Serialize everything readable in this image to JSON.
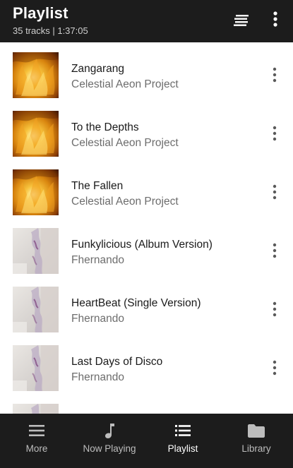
{
  "header": {
    "title": "Playlist",
    "subtitle": "35 tracks | 1:37:05",
    "sort_icon": "queue-sort-icon",
    "overflow_icon": "more-vert-icon"
  },
  "tracks": [
    {
      "title": "Zangarang",
      "artist": "Celestial Aeon Project",
      "art": "fire"
    },
    {
      "title": "To the Depths",
      "artist": "Celestial Aeon Project",
      "art": "fire"
    },
    {
      "title": "The Fallen",
      "artist": "Celestial Aeon Project",
      "art": "fire"
    },
    {
      "title": "Funkylicious (Album Version)",
      "artist": "Fhernando",
      "art": "pale"
    },
    {
      "title": "HeartBeat (Single Version)",
      "artist": "Fhernando",
      "art": "pale"
    },
    {
      "title": "Last Days of Disco",
      "artist": "Fhernando",
      "art": "pale"
    },
    {
      "title": "",
      "artist": "",
      "art": "pale"
    }
  ],
  "nav": {
    "items": [
      {
        "label": "More",
        "icon": "menu-icon"
      },
      {
        "label": "Now Playing",
        "icon": "music-note-icon"
      },
      {
        "label": "Playlist",
        "icon": "list-icon"
      },
      {
        "label": "Library",
        "icon": "folder-icon"
      }
    ],
    "active": "Playlist"
  },
  "colors": {
    "bar_background": "#1c1c1c",
    "active_text": "#ffffff",
    "inactive_text": "#bdbdbd",
    "secondary_text": "#6d6d6d"
  }
}
